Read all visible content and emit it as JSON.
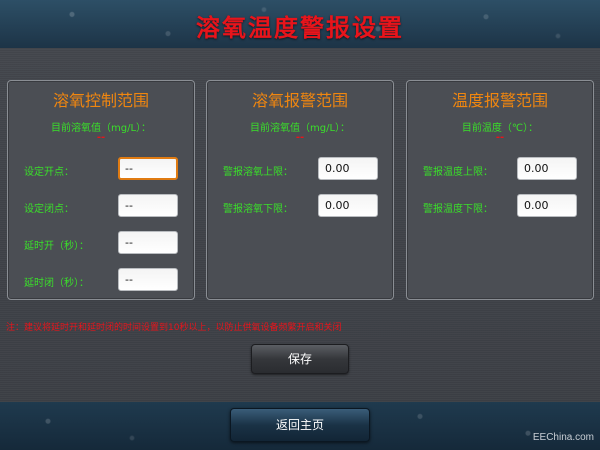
{
  "header": {
    "title": "溶氧温度警报设置"
  },
  "panels": {
    "control": {
      "title": "溶氧控制范围",
      "current_label": "目前溶氧值（mg/L）：",
      "current_value": "--",
      "rows": [
        {
          "label": "设定开点：",
          "value": "--"
        },
        {
          "label": "设定闭点：",
          "value": "--"
        },
        {
          "label": "延时开（秒）：",
          "value": "--"
        },
        {
          "label": "延时闭（秒）：",
          "value": "--"
        }
      ]
    },
    "do_alarm": {
      "title": "溶氧报警范围",
      "current_label": "目前溶氧值（mg/L）：",
      "current_value": "--",
      "rows": [
        {
          "label": "警报溶氧上限：",
          "value": "0.00"
        },
        {
          "label": "警报溶氧下限：",
          "value": "0.00"
        }
      ]
    },
    "temp_alarm": {
      "title": "温度报警范围",
      "current_label": "目前温度（℃）：",
      "current_value": "--",
      "rows": [
        {
          "label": "警报温度上限：",
          "value": "0.00"
        },
        {
          "label": "警报温度下限：",
          "value": "0.00"
        }
      ]
    }
  },
  "note": "注：建议将延时开和延时闭的时间设置到10秒以上，以防止供氧设备频繁开启和关闭",
  "buttons": {
    "save": "保存",
    "home": "返回主页"
  },
  "watermark": "EEChina.com",
  "colors": {
    "title": "#e8141b",
    "panel_title": "#f0860f",
    "label": "#3adf2a",
    "focus": "#e07b12"
  }
}
